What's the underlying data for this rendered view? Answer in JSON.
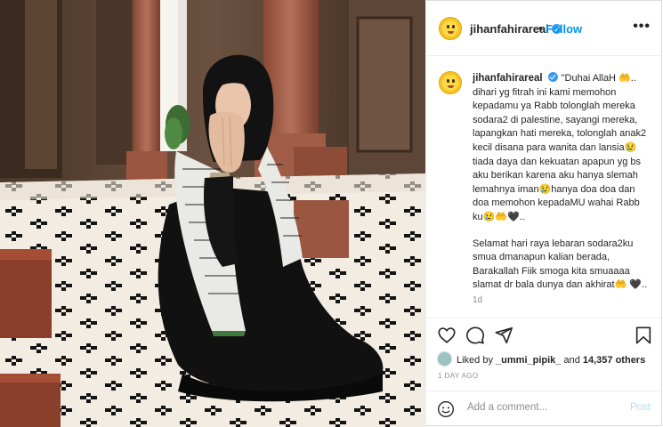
{
  "post": {
    "username": "jihanfahirareal",
    "follow_label": "Follow",
    "dot_separator": "•",
    "more_icon_label": "•••"
  },
  "caption": {
    "username": "jihanfahirareal",
    "paragraph1": "\"Duhai AllaH 🤲.. dihari yg fitrah ini kami memohon kepadamu ya Rabb tolonglah mereka sodara2 di palestine, sayangi mereka, lapangkan hati mereka, tolonglah anak2 kecil disana para wanita dan lansia😢 tiada daya dan kekuatan apapun yg bs aku berikan karena aku hanya slemah lemahnya iman😢hanya doa doa dan doa memohon kepadaMU wahai Rabb ku😢🤲🖤..",
    "paragraph2": "Selamat hari raya lebaran sodara2ku smua dmanapun kalian berada, Barakallah Fiik smoga kita smuaaaa slamat dr bala dunya dan akhirat🤲 🖤..",
    "time_ago": "1d"
  },
  "likes": {
    "prefix": "Liked by",
    "user": "_ummi_pipik_",
    "and": "and",
    "others": "14,357 others"
  },
  "date_label": "1 DAY AGO",
  "comment": {
    "placeholder": "Add a comment...",
    "post_label": "Post"
  },
  "icons": {
    "heart": "heart-icon",
    "comment": "comment-icon",
    "share": "paper-plane-icon",
    "save": "bookmark-icon",
    "emoji": "emoji-icon",
    "verified": "verified-badge-icon"
  },
  "colors": {
    "follow": "#0095f6",
    "post_disabled": "#b2dffc",
    "verified": "#3897f0"
  }
}
